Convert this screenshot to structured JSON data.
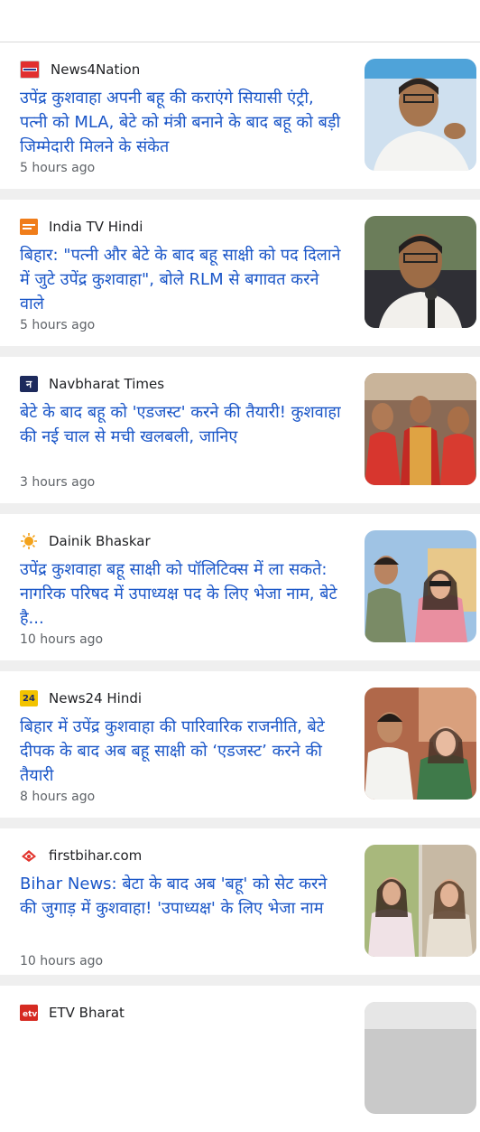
{
  "articles": [
    {
      "source": "News4Nation",
      "logo_icon": "news4nation-logo-icon",
      "headline": "उपेंद्र कुशवाहा अपनी बहू की कराएंगे सियासी एंट्री, पत्नी को MLA, बेटे को मंत्री बनाने के बाद बहू को बड़ी जिम्मेदारी मिलने के संकेत",
      "time": "5 hours ago"
    },
    {
      "source": "India TV Hindi",
      "logo_icon": "india-tv-logo-icon",
      "headline": "बिहार: \"पत्नी और बेटे के बाद बहू साक्षी को पद दिलाने में जुटे उपेंद्र कुशवाहा\", बोले RLM से बगावत करने वाले",
      "time": "5 hours ago"
    },
    {
      "source": "Navbharat Times",
      "logo_icon": "navbharat-times-logo-icon",
      "logo_text": "न",
      "headline": "बेटे के बाद बहू को 'एडजस्ट' करने की तैयारी! कुशवाहा की नई चाल से मची खलबली, जानिए",
      "time": "3 hours ago"
    },
    {
      "source": "Dainik Bhaskar",
      "logo_icon": "dainik-bhaskar-sun-logo-icon",
      "headline": "उपेंद्र कुशवाहा बहू साक्षी को पॉलिटिक्स में ला सकते: नागरिक परिषद में उपाध्यक्ष पद के लिए भेजा नाम, बेटे है...",
      "time": "10 hours ago"
    },
    {
      "source": "News24 Hindi",
      "logo_icon": "news24-logo-icon",
      "logo_text": "24",
      "headline": "बिहार में उपेंद्र कुशवाहा की पारिवारिक राजनीति, बेटे दीपक के बाद अब बहू साक्षी को ‘एडजस्ट’ करने की तैयारी",
      "time": "8 hours ago"
    },
    {
      "source": "firstbihar.com",
      "logo_icon": "firstbihar-logo-icon",
      "headline": "Bihar News: बेटा के बाद अब 'बहू' को सेट करने की जुगाड़ में कुशवाहा! 'उपाध्यक्ष' के लिए भेजा नाम",
      "time": "10 hours ago"
    },
    {
      "source": "ETV Bharat",
      "logo_icon": "etv-bharat-logo-icon",
      "headline": "",
      "time": ""
    }
  ]
}
